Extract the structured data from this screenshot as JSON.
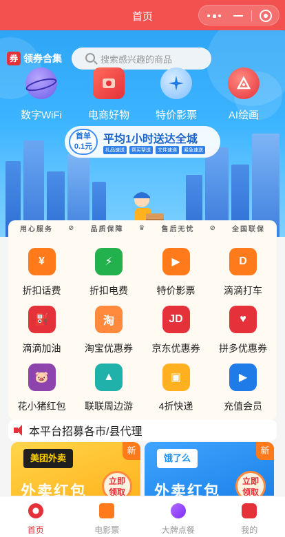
{
  "titlebar": {
    "title": "首页"
  },
  "header": {
    "coupon_badge_glyph": "券",
    "coupon_badge_label": "领券合集",
    "search_placeholder": "搜索感兴趣的商品"
  },
  "top_nav": [
    {
      "label": "数字WiFi",
      "icon": "planet-icon",
      "color": "#6c5ce7"
    },
    {
      "label": "电商好物",
      "icon": "shopping-tag-icon",
      "color": "#e5313a"
    },
    {
      "label": "特价影票",
      "icon": "sparkle-icon",
      "color": "#1e7be8"
    },
    {
      "label": "AI绘画",
      "icon": "palette-icon",
      "color": "#e5313a"
    }
  ],
  "banner": {
    "first_order_line1": "首单",
    "first_order_line2": "0.1元",
    "headline": "平均1小时送达全城",
    "chips": [
      "礼品速送",
      "帮买帮送",
      "文件速递",
      "紧急速送"
    ]
  },
  "service_guarantees": [
    "用心服务",
    "品质保障",
    "售后无忧",
    "全国联保"
  ],
  "services": [
    {
      "label": "折扣话费",
      "icon": "phone-bill-icon",
      "color": "#ff7a1a",
      "glyph": "¥"
    },
    {
      "label": "折扣电费",
      "icon": "battery-icon",
      "color": "#22b14c",
      "glyph": "⚡"
    },
    {
      "label": "特价影票",
      "icon": "movie-ticket-icon",
      "color": "#ff7a1a",
      "glyph": "▶"
    },
    {
      "label": "滴滴打车",
      "icon": "didi-icon",
      "color": "#ff7a1a",
      "glyph": "D"
    },
    {
      "label": "滴滴加油",
      "icon": "fuel-pump-icon",
      "color": "#e5313a",
      "glyph": "⛽"
    },
    {
      "label": "淘宝优惠券",
      "icon": "taobao-icon",
      "color": "#ff8a3d",
      "glyph": "淘"
    },
    {
      "label": "京东优惠券",
      "icon": "jd-icon",
      "color": "#e5313a",
      "glyph": "JD"
    },
    {
      "label": "拼多优惠券",
      "icon": "pdd-icon",
      "color": "#e5313a",
      "glyph": "♥"
    },
    {
      "label": "花小猪红包",
      "icon": "pig-icon",
      "color": "#8e44ad",
      "glyph": "🐷"
    },
    {
      "label": "联联周边游",
      "icon": "mountain-icon",
      "color": "#20b2aa",
      "glyph": "▲"
    },
    {
      "label": "4折快递",
      "icon": "parcel-icon",
      "color": "#ffb020",
      "glyph": "▣"
    },
    {
      "label": "充值会员",
      "icon": "play-icon",
      "color": "#1e7be8",
      "glyph": "▶"
    }
  ],
  "notice": {
    "text": "本平台招募各市/县代理"
  },
  "promos": [
    {
      "brand": "美团外卖",
      "new_badge": "新",
      "title": "外卖红包",
      "cta_line1": "立即",
      "cta_line2": "领取",
      "bg": "#ffc021",
      "brand_bg": "#1f1f1f",
      "brand_color": "#ffd100"
    },
    {
      "brand": "饿了么",
      "new_badge": "新",
      "title": "外卖红包",
      "cta_line1": "立即",
      "cta_line2": "领取",
      "bg": "#1e8ff0",
      "brand_bg": "#ffffff",
      "brand_color": "#1e8ff0"
    }
  ],
  "tabbar": [
    {
      "label": "首页",
      "icon": "home-icon",
      "active": true,
      "color": "#e5313a"
    },
    {
      "label": "电影票",
      "icon": "film-icon",
      "active": false,
      "color": "#ff7a1a"
    },
    {
      "label": "大牌点餐",
      "icon": "new-badge-icon",
      "active": false,
      "color": "#8e44ad"
    },
    {
      "label": "我的",
      "icon": "profile-icon",
      "active": false,
      "color": "#e5313a"
    }
  ]
}
